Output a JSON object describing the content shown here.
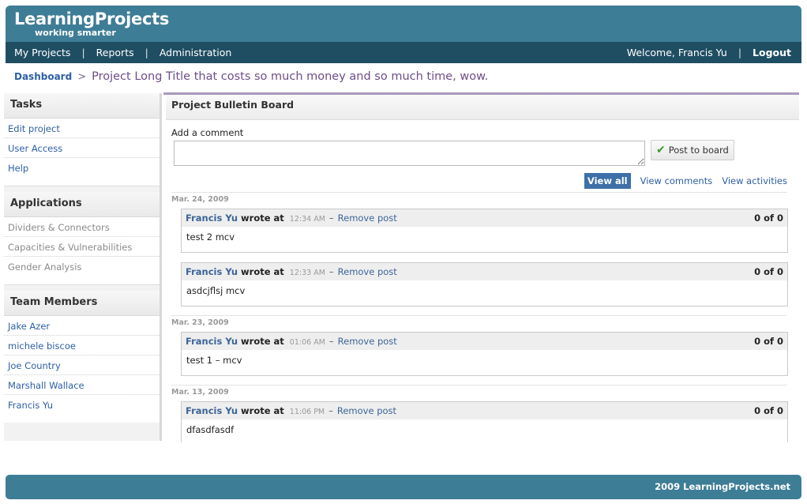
{
  "brand": {
    "name": "LearningProjects",
    "tagline": "working smarter"
  },
  "nav": {
    "items": [
      {
        "label": "My Projects"
      },
      {
        "label": "Reports"
      },
      {
        "label": "Administration"
      }
    ],
    "separator": "|",
    "welcome": "Welcome, Francis Yu",
    "logout": "Logout"
  },
  "breadcrumb": {
    "root": "Dashboard",
    "separator": ">",
    "title": "Project Long Title that costs so much money and so much time, wow."
  },
  "sidebar": {
    "tasks": {
      "heading": "Tasks",
      "items": [
        {
          "label": "Edit project"
        },
        {
          "label": "User Access"
        },
        {
          "label": "Help"
        }
      ]
    },
    "applications": {
      "heading": "Applications",
      "items": [
        {
          "label": "Dividers & Connectors"
        },
        {
          "label": "Capacities & Vulnerabilities"
        },
        {
          "label": "Gender Analysis"
        }
      ]
    },
    "team": {
      "heading": "Team Members",
      "items": [
        {
          "label": "Jake Azer"
        },
        {
          "label": "michele biscoe"
        },
        {
          "label": "Joe Country"
        },
        {
          "label": "Marshall Wallace"
        },
        {
          "label": "Francis Yu"
        }
      ]
    }
  },
  "board": {
    "title": "Project Bulletin Board",
    "add_label": "Add a comment",
    "comment_value": "",
    "post_button": "Post to board",
    "filters": {
      "all": "View all",
      "comments": "View comments",
      "activities": "View activities"
    },
    "dates": [
      "Mar. 24, 2009",
      "Mar. 23, 2009",
      "Mar. 13, 2009"
    ],
    "posts": [
      {
        "author": "Francis Yu",
        "wrote": "wrote at",
        "time": "12:34 AM",
        "dash": "–",
        "remove": "Remove post",
        "count": "0 of 0",
        "body": "test 2 mcv"
      },
      {
        "author": "Francis Yu",
        "wrote": "wrote at",
        "time": "12:33 AM",
        "dash": "–",
        "remove": "Remove post",
        "count": "0 of 0",
        "body": "asdcjflsj mcv"
      },
      {
        "author": "Francis Yu",
        "wrote": "wrote at",
        "time": "01:06 AM",
        "dash": "–",
        "remove": "Remove post",
        "count": "0 of 0",
        "body": "test 1 – mcv"
      },
      {
        "author": "Francis Yu",
        "wrote": "wrote at",
        "time": "11:06 PM",
        "dash": "–",
        "remove": "Remove post",
        "count": "0 of 0",
        "body": "dfasdfasdf"
      }
    ]
  },
  "footer": {
    "text": "2009 LearningProjects.net"
  },
  "colors": {
    "header": "#3e7d96",
    "navbar": "#1f4e63",
    "link": "#2d5fa5",
    "accent_purple": "#a99abc",
    "active_filter": "#3d6fa8"
  },
  "icons": {
    "post_button": "check-icon"
  }
}
